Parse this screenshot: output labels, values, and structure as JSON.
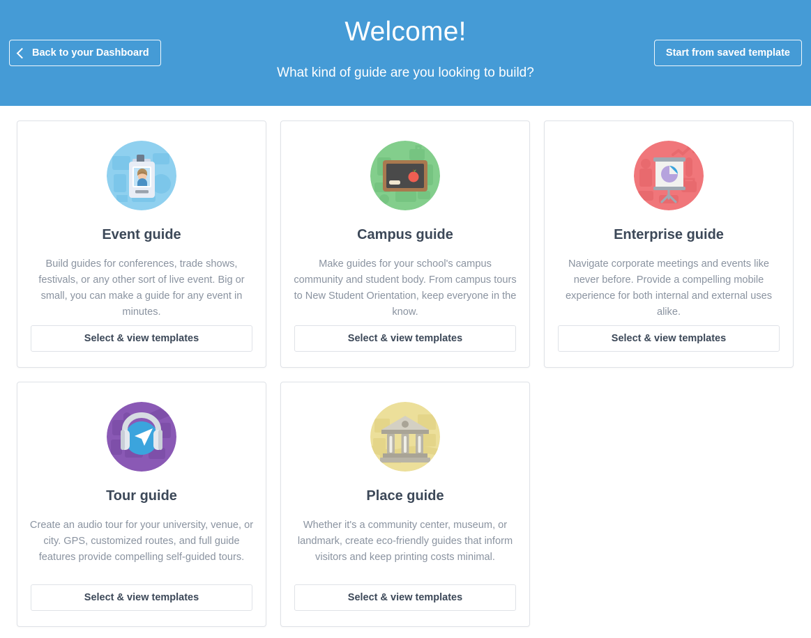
{
  "colors": {
    "header_blue": "#459bd6",
    "card_border": "#dfe2e7",
    "title_text": "#3c4858",
    "body_text": "#8a93a0"
  },
  "header": {
    "title": "Welcome!",
    "subtitle": "What kind of guide are you looking to build?",
    "back_button": "Back to your Dashboard",
    "back_icon": "chevron-left-icon",
    "saved_template_button": "Start from saved template"
  },
  "cards": [
    {
      "id": "event-guide",
      "title": "Event guide",
      "description": "Build guides for conferences, trade shows, festivals, or any other sort of live event. Big or small, you can make a guide for any event in minutes.",
      "cta": "Select & view templates",
      "icon": "id-badge-icon",
      "icon_bg": "#8fd0ef"
    },
    {
      "id": "campus-guide",
      "title": "Campus guide",
      "description": "Make guides for your school's campus community and student body. From campus tours to New Student Orientation, keep everyone in the know.",
      "cta": "Select & view templates",
      "icon": "chalkboard-icon",
      "icon_bg": "#83ce8c"
    },
    {
      "id": "enterprise-guide",
      "title": "Enterprise guide",
      "description": "Navigate corporate meetings and events like never before. Provide a compelling mobile experience for both internal and external uses alike.",
      "cta": "Select & view templates",
      "icon": "presentation-chart-icon",
      "icon_bg": "#f0767a"
    },
    {
      "id": "tour-guide",
      "title": "Tour guide",
      "description": "Create an audio tour for your university, venue, or city. GPS, customized routes, and full guide features provide compelling self-guided tours.",
      "cta": "Select & view templates",
      "icon": "headphones-navigation-icon",
      "icon_bg": "#8a59b5"
    },
    {
      "id": "place-guide",
      "title": "Place guide",
      "description": "Whether it's a community center, museum, or landmark, create eco-friendly guides that inform visitors and keep printing costs minimal.",
      "cta": "Select & view templates",
      "icon": "museum-building-icon",
      "icon_bg": "#ecdf9a"
    }
  ]
}
